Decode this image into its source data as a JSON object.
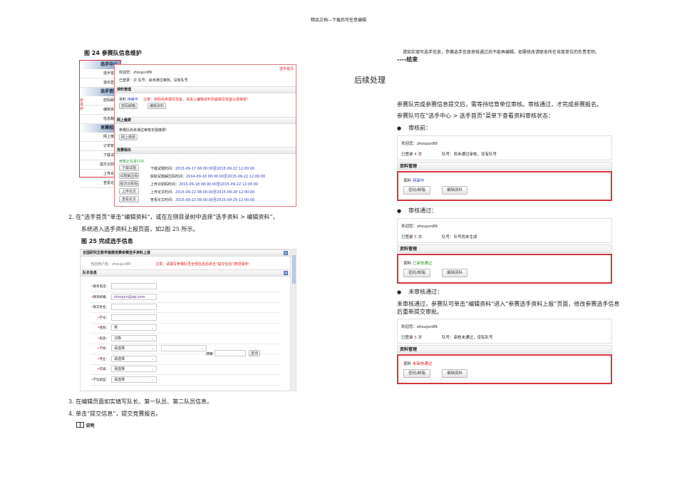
{
  "header": "精品文档---下载后可任意编辑",
  "fig24": {
    "caption": "图 24 参赛队信息维护",
    "side_label": "目录树",
    "sidebar": [
      {
        "head": "选手中心",
        "items": [
          "选手首页",
          "退出登录"
        ]
      },
      {
        "head": "选手资料",
        "items": [
          "密码邮箱",
          "编辑资料",
          "信息翻样"
        ]
      },
      {
        "head": "竞赛相关",
        "items": [
          "网上缴费",
          "订单管理",
          "下载试题",
          "提交识别码",
          "上传论文",
          "查看论文"
        ]
      }
    ],
    "corner_label": "选手首页",
    "welcome": "欢迎您：zhoujun89",
    "login_line": "已登录：次    队号：尚未通过审核，没有队号",
    "sec1": "资料管理",
    "status_label": "资料",
    "status_value": "待审中",
    "notice": "注意：资料尚未填写完善，请进入编辑资料页面填写完善以便审核!",
    "btn_pwd": "密码邮箱",
    "btn_edit": "编辑资料",
    "sec2": "网上缴费",
    "pay_text": "参赛队尚未通过审核无需缴费!",
    "btn_pay": "网上缴费",
    "sec3": "竞赛相关",
    "contest_status": "竞赛正在进行中",
    "rows": [
      {
        "btn": "下载试题",
        "label": "下载试题时间：",
        "time": "2015-09-17 08:00:00至2015-09-22 12:00:00"
      },
      {
        "btn": "试题解压码",
        "label": "获取试题解压码时间：",
        "time": "2014-09-18 08:00:00至2015-09-22 12:00:00"
      },
      {
        "btn": "提交识别码",
        "label": "上传识别码时间：",
        "time": "2015-09-18 08:00:00至2015-09-22 12:00:00"
      },
      {
        "btn": "上传论文",
        "label": "上传论文时间：",
        "time": "2015-09-22 08:00:00至2015-09-28 12:00:00"
      },
      {
        "btn": "查看论文",
        "label": "查看论文时间：",
        "time": "2015-09-22 08:00:00至2015-09-29 12:00:00"
      }
    ]
  },
  "step2_line1": "2.   在“选手首页”单击“编辑资料”，或在左侧目录树中选择“选手资料 > 编辑资料”，",
  "step2_line2": "系统进入选手资料上报页面，如2图 25 所示。",
  "fig25": {
    "caption": "图 25 完成选手信息",
    "title": "全国研究生数学建模竞赛参赛选手资料上报",
    "user_label": "当前用户名：zhoujun89",
    "notice": "注意：请填写参赛队员全部信息后单击“提交信息”按钮保存!",
    "section": "队长信息",
    "fields": [
      {
        "label": "联系电话：",
        "value": ""
      },
      {
        "label": "联系邮箱：",
        "value": "zhoujun@qq.com"
      },
      {
        "label": "真实姓名：",
        "value": ""
      },
      {
        "label": "学号：",
        "value": ""
      },
      {
        "label": "性别：",
        "value": "男"
      },
      {
        "label": "民族：",
        "value": "汉族"
      },
      {
        "label": "学校：",
        "value": "请选择"
      },
      {
        "label": "专业：",
        "value": "请选择"
      },
      {
        "label": "年级：",
        "value": "请选择"
      },
      {
        "label": "学位类型：",
        "value": "请选择"
      }
    ],
    "search_label": "搜索",
    "search_btn": "查询"
  },
  "step3": "3.   在编辑页面如实填写队长、第一队员、第二队员信息。",
  "step4": "4.   单击“提交信息”，提交竞赛报名。",
  "note_label": "说明",
  "right": {
    "note_text": "请如实填写选手信息，参赛选手信息审核通过后不能再编辑，如需修改请联系所在培育单位的负责老师。",
    "end": "----结束",
    "heading": "后续处理",
    "para1": "参赛队完成参赛信息提交后，需等待培育单位审核。审核通过，才完成参赛报名。",
    "para2": "参赛队可在“选手中心 > 选手首页”菜单下查看资料审核状态：",
    "bullet1": "审核前：",
    "bullet2": "审核通过：",
    "bullet3": "未审核通过：",
    "para3a": "未审核通过，参赛队可单击“编辑资料”进入“参赛选手资料上报”页面，修改参赛选手信息",
    "para3b": "后重新提交审批。",
    "boxes": [
      {
        "welcome": "欢迎您：zhoujun89",
        "login_prefix": "已登录",
        "count": "4",
        "login_suffix": "次",
        "team": "队号：尚未通过审核，没有队号",
        "head": "资料管理",
        "status_label": "资料",
        "status": "待审中",
        "status_color": "#2233cc",
        "btn1": "密码/邮箱",
        "btn2": "编辑资料"
      },
      {
        "welcome": "欢迎您：zhoujun89",
        "login_prefix": "已登录",
        "count": "5",
        "login_suffix": "次",
        "team": "队号：队号尚未生成",
        "head": "资料管理",
        "status_label": "资料",
        "status": "已审核通过",
        "status_color": "#2a9a2a",
        "btn1": "密码/邮箱",
        "btn2": "编辑资料"
      },
      {
        "welcome": "欢迎您：zhoujun89",
        "login_prefix": "已登录",
        "count": "5",
        "login_suffix": "次",
        "team": "队号：审核未通过，没有队号",
        "head": "资料管理",
        "status_label": "资料",
        "status": "未审核通过",
        "status_color": "#e02020",
        "btn1": "密码/邮箱",
        "btn2": "编辑资料"
      }
    ]
  }
}
